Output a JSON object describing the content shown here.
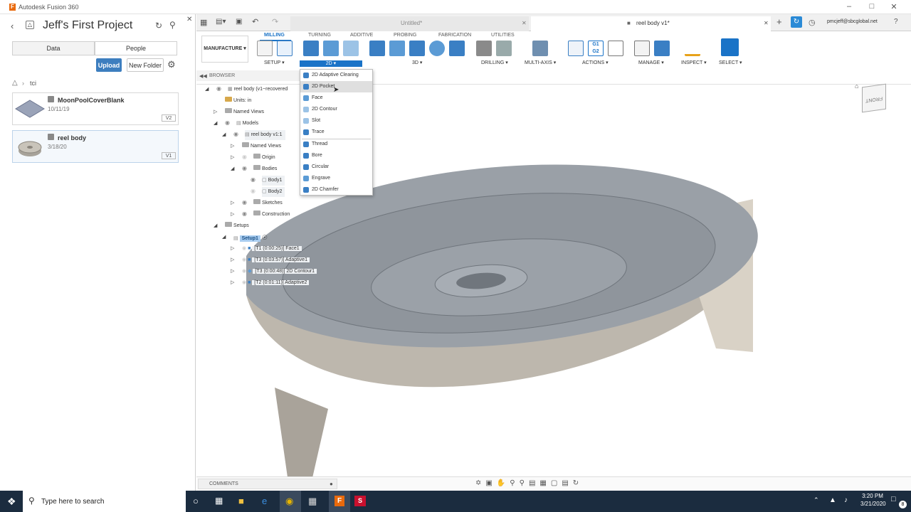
{
  "window": {
    "title": "Autodesk Fusion 360",
    "app_icon": "F"
  },
  "datapanel": {
    "project_title": "Jeff's First Project",
    "tab_data": "Data",
    "tab_people": "People",
    "upload_label": "Upload",
    "new_folder_label": "New Folder",
    "breadcrumb": "tci",
    "items": [
      {
        "name": "MoonPoolCoverBlank",
        "date": "10/11/19",
        "version": "V2"
      },
      {
        "name": "reel body",
        "date": "3/18/20",
        "version": "V1"
      }
    ]
  },
  "doctabs": {
    "untitled": "Untitled*",
    "active": "reel body v1*",
    "user": "pmcjeff@sbcglobal.net"
  },
  "ribbon": {
    "workspace": "MANUFACTURE",
    "tabs": [
      "MILLING",
      "TURNING",
      "ADDITIVE",
      "PROBING",
      "FABRICATION",
      "UTILITIES"
    ],
    "groups": {
      "setup": "SETUP",
      "twod": "2D",
      "threed": "3D",
      "drilling": "DRILLING",
      "multiaxis": "MULTI-AXIS",
      "actions": "ACTIONS",
      "manage": "MANAGE",
      "inspect": "INSPECT",
      "select": "SELECT"
    }
  },
  "browser": {
    "header": "BROWSER",
    "root": "reel body (v1~recovered",
    "units": "Units: in",
    "named_views": "Named Views",
    "models": "Models",
    "model_comp": "reel body v1:1",
    "named_views2": "Named Views",
    "origin": "Origin",
    "bodies": "Bodies",
    "body1": "Body1",
    "body2": "Body2",
    "sketches": "Sketches",
    "construction": "Construction",
    "setups": "Setups",
    "setup1": "Setup1",
    "ops": [
      "[T1 (0:00:25)] Face1",
      "[T3 (0:03:57)] Adaptive1",
      "[T3 (0:00:48)] 2D Contour1",
      "[T2 (0:01:11)] Adaptive2"
    ]
  },
  "dropdown": {
    "items": [
      "2D Adaptive Clearing",
      "2D Pocket",
      "Face",
      "2D Contour",
      "Slot",
      "Trace",
      "Thread",
      "Bore",
      "Circular",
      "Engrave",
      "2D Chamfer"
    ]
  },
  "viewcube_label": "FRONT",
  "comments_label": "COMMENTS",
  "taskbar": {
    "search_placeholder": "Type here to search",
    "time": "3:20 PM",
    "date": "3/21/2020",
    "notifications": "8"
  }
}
